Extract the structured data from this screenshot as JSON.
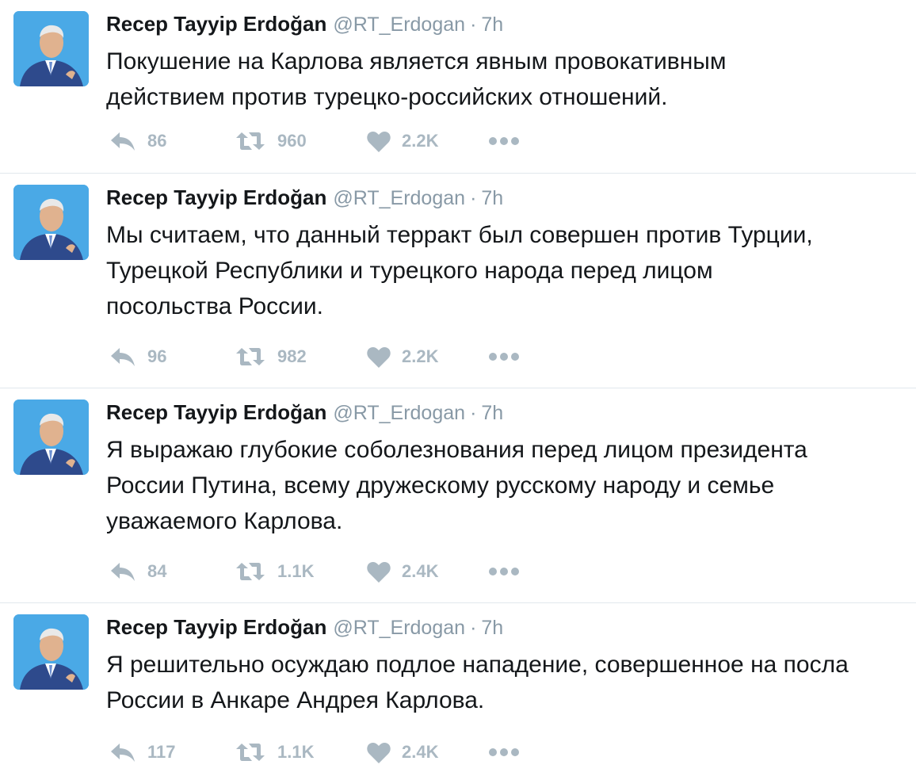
{
  "colors": {
    "name": "#14171a",
    "meta": "#8899a6",
    "icon": "#aab8c2",
    "divider": "#e1e8ed",
    "avatar_bg": "#4aa9e6"
  },
  "tweets": [
    {
      "name": "Recep Tayyip Erdoğan",
      "handle": "@RT_Erdogan",
      "sep": "·",
      "time": "7h",
      "lines": [
        "Покушение на Карлова является явным провокативным",
        "действием против турецко-российских отношений."
      ],
      "replies": "86",
      "retweets": "960",
      "likes": "2.2K"
    },
    {
      "name": "Recep Tayyip Erdoğan",
      "handle": "@RT_Erdogan",
      "sep": "·",
      "time": "7h",
      "lines": [
        "Мы считаем, что данный терракт был совершен против Турции,",
        "Турецкой Республики и турецкого народа перед лицом",
        "посольства России."
      ],
      "replies": "96",
      "retweets": "982",
      "likes": "2.2K"
    },
    {
      "name": "Recep Tayyip Erdoğan",
      "handle": "@RT_Erdogan",
      "sep": "·",
      "time": "7h",
      "lines": [
        "Я выражаю глубокие соболезнования перед лицом президента",
        "России Путина, всему дружескому русскому народу и семье",
        "уважаемого Карлова."
      ],
      "replies": "84",
      "retweets": "1.1K",
      "likes": "2.4K"
    },
    {
      "name": "Recep Tayyip Erdoğan",
      "handle": "@RT_Erdogan",
      "sep": "·",
      "time": "7h",
      "lines": [
        "Я решительно осуждаю подлое нападение, совершенное на посла",
        "России в Анкаре Андрея Карлова."
      ],
      "replies": "117",
      "retweets": "1.1K",
      "likes": "2.4K"
    }
  ],
  "icons": {
    "reply": "reply-icon",
    "retweet": "retweet-icon",
    "like": "heart-icon",
    "more": "more-dots-icon",
    "avatar": "avatar"
  }
}
